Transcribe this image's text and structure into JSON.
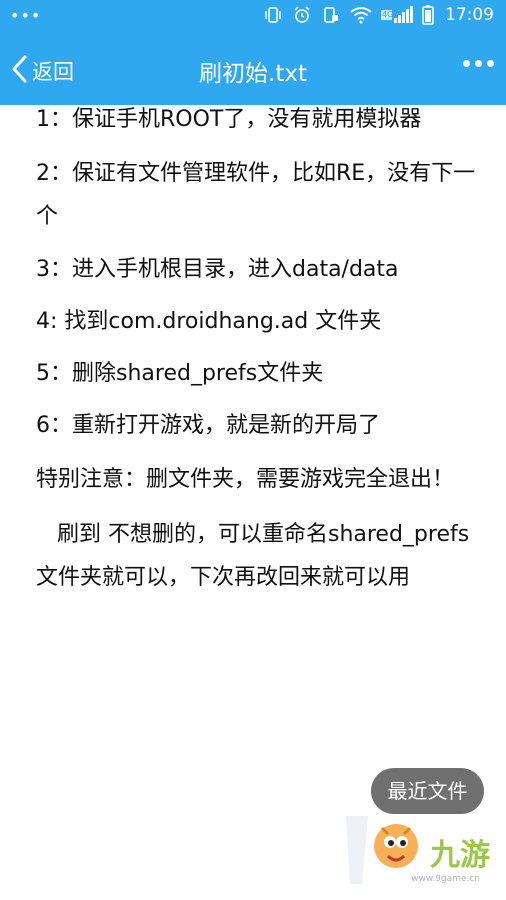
{
  "status_bar": {
    "dots": "•••",
    "network_badge": "4G",
    "time": "17:09"
  },
  "app_bar": {
    "back_label": "返回",
    "title": "刷初始.txt"
  },
  "document": {
    "lines": [
      "1：保证手机ROOT了，没有就用模拟器",
      "2：保证有文件管理软件，比如RE，没有下一个",
      "3：进入手机根目录，进入data/data",
      "4: 找到com.droidhang.ad 文件夹",
      "5：删除shared_prefs文件夹",
      "6：重新打开游戏，就是新的开局了",
      "特别注意：删文件夹，需要游戏完全退出！",
      "   刷到 不想删的，可以重命名shared_prefs文件夹就可以，下次再改回来就可以用"
    ]
  },
  "fab": {
    "label": "最近文件"
  },
  "watermark": {
    "brand": "九游",
    "site": "www.9game.cn"
  },
  "colors": {
    "appbar": "#2fa8ef",
    "fab": "#707070",
    "text": "#111111"
  }
}
